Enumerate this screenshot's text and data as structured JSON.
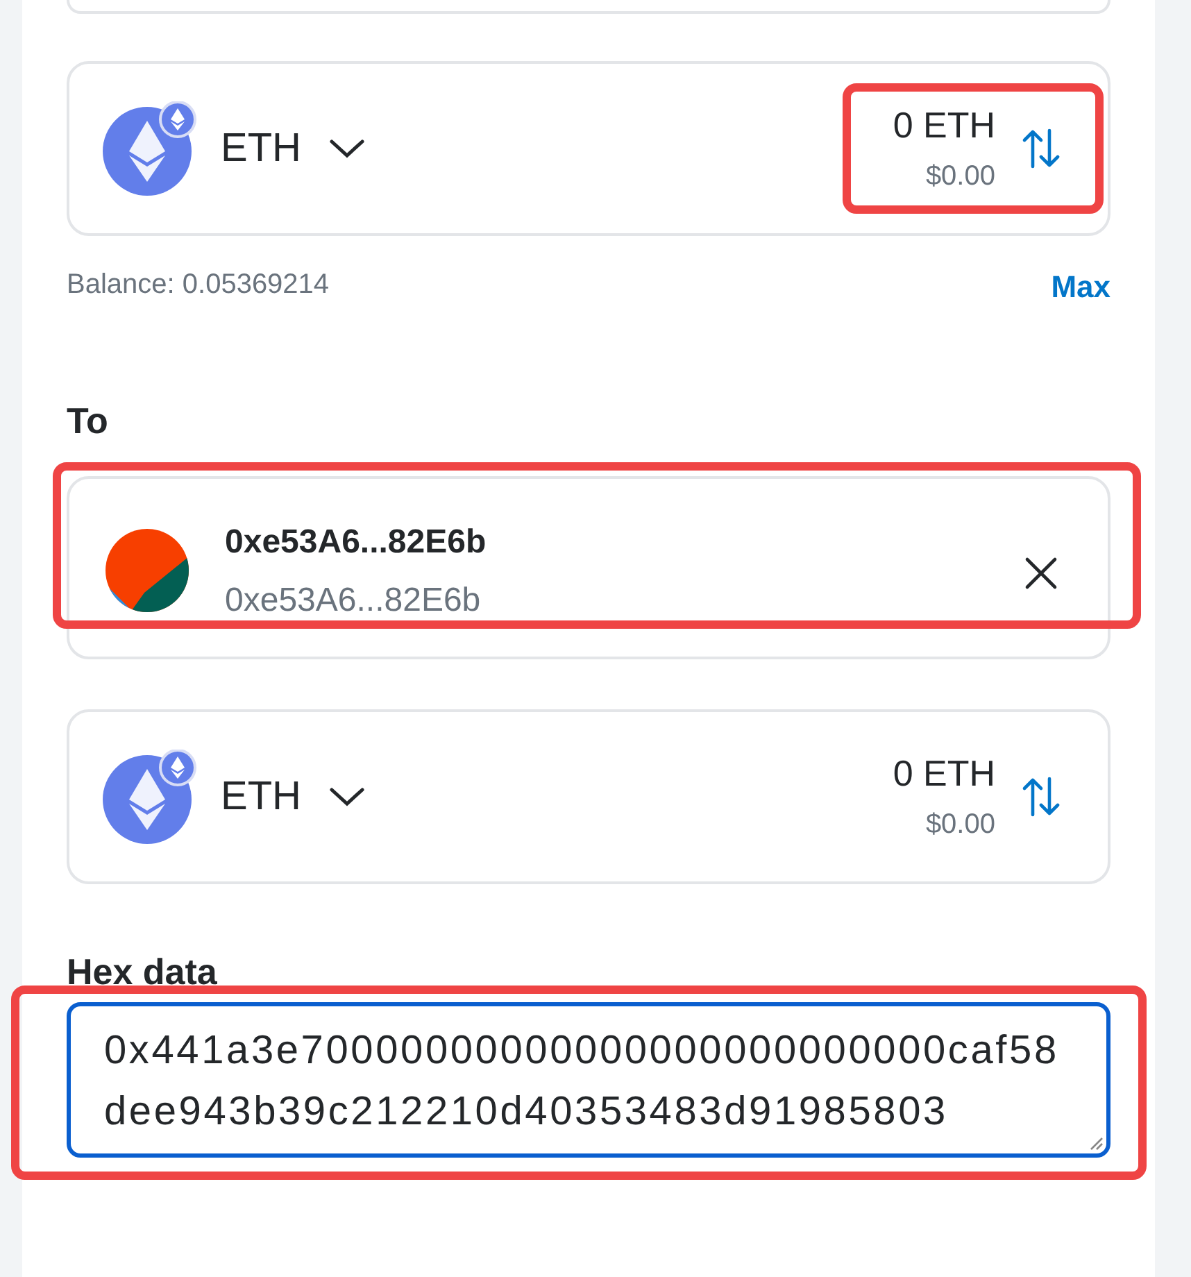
{
  "send_asset": {
    "symbol": "ETH",
    "amount": "0 ETH",
    "fiat": "$0.00",
    "highlighted": true
  },
  "balance": "Balance: 0.05369214",
  "max_button": "Max",
  "recipient": {
    "label": "To",
    "name": "0xe53A6...82E6b",
    "address": "0xe53A6...82E6b",
    "highlighted": true
  },
  "receive_asset": {
    "symbol": "ETH",
    "amount": "0 ETH",
    "fiat": "$0.00",
    "highlighted": false
  },
  "hex_data": {
    "label": "Hex data",
    "value": "0x441a3e70000000000000000000000000caf58dee943b39c212210d40353483d91985803",
    "highlighted": true
  }
}
